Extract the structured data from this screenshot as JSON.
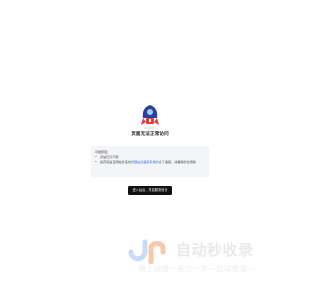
{
  "title": "页面无法正常访问",
  "hint": {
    "heading": "可能原因：",
    "items": [
      {
        "text": "该站已打不能"
      },
      {
        "prefix": "如存您是互网站长来也",
        "link": "管理站点备案系统状态",
        "suffix": "了备案，请看案的位用情"
      }
    ]
  },
  "cta_label": "进入后台，开启服务设计",
  "watermark": {
    "title": "自动秒收录",
    "subtitle": "做上链接一来访一次—自动收录—",
    "accent": "#f7c9a8",
    "mark": "#c9dcf5"
  },
  "colors": {
    "link": "#2d6fd8",
    "button_bg": "#111111",
    "hint_bg": "#f4f5f7"
  }
}
